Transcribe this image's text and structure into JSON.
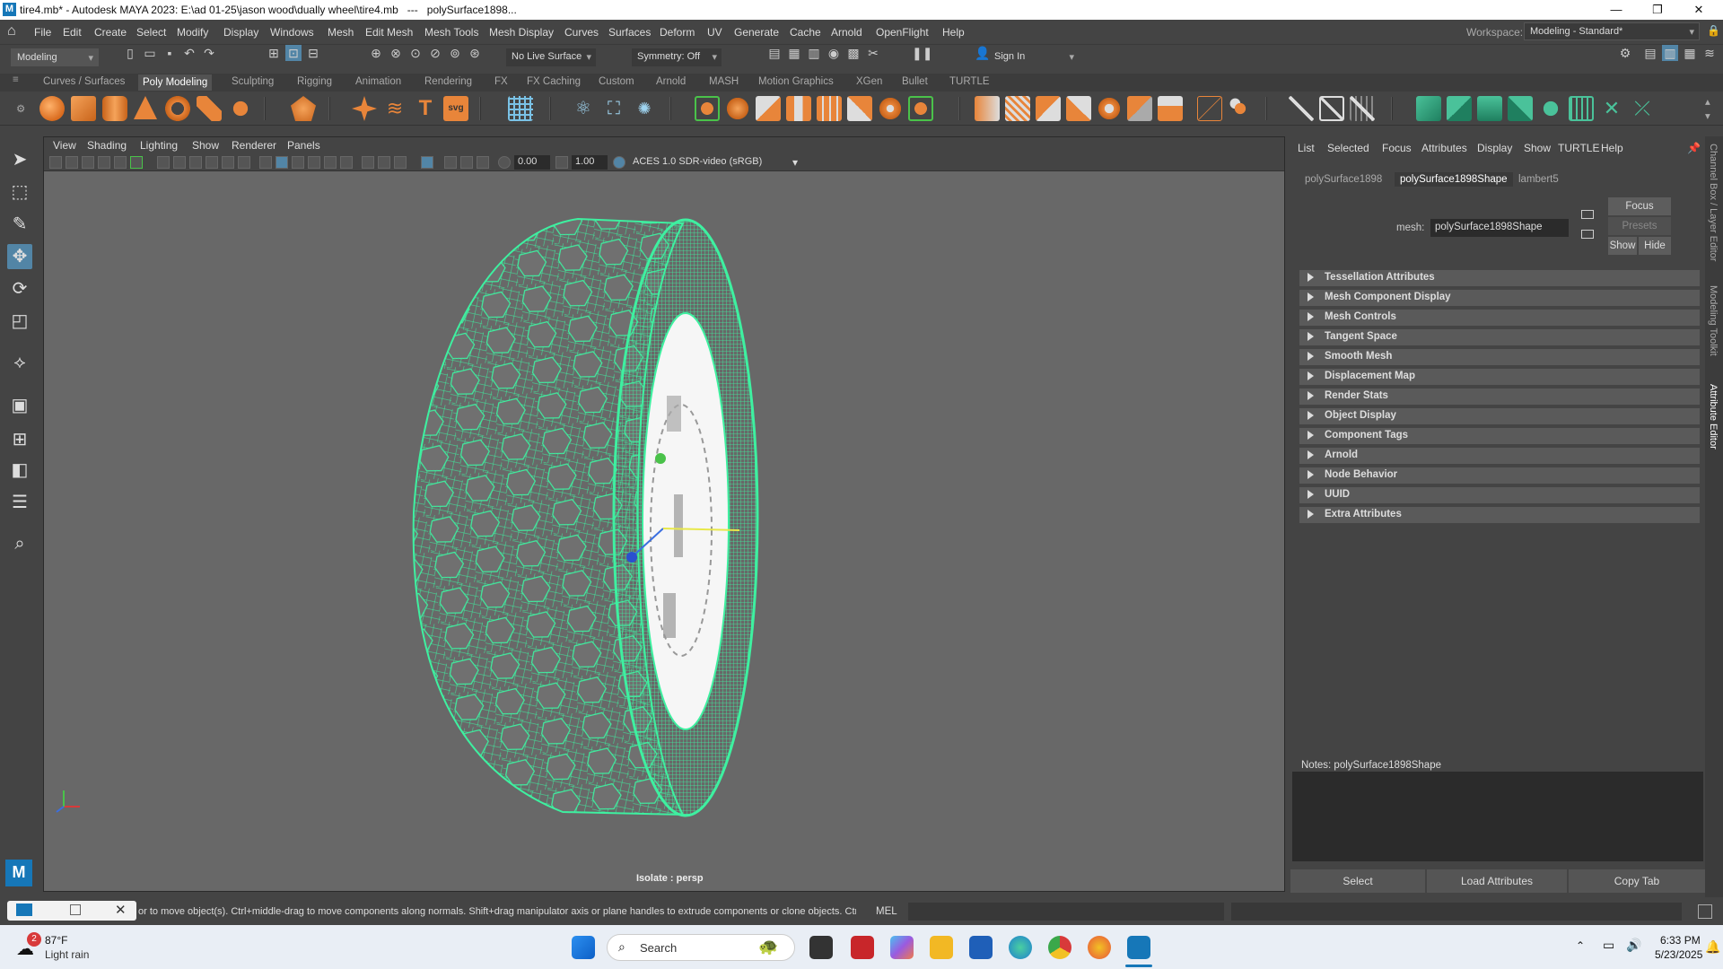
{
  "titlebar": {
    "text": "tire4.mb* - Autodesk MAYA 2023: E:\\ad 01-25\\jason wood\\dually wheel\\tire4.mb   ---   polySurface1898...",
    "minimize": "—",
    "maximize": "❐",
    "close": "✕"
  },
  "menubar": {
    "items": [
      "File",
      "Edit",
      "Create",
      "Select",
      "Modify",
      "Display",
      "Windows",
      "Mesh",
      "Edit Mesh",
      "Mesh Tools",
      "Mesh Display",
      "Curves",
      "Surfaces",
      "Deform",
      "UV",
      "Generate",
      "Cache",
      "Arnold",
      "OpenFlight",
      "Help"
    ],
    "workspace_label": "Workspace:",
    "workspace_value": "Modeling - Standard*"
  },
  "statusline": {
    "mode": "Modeling",
    "live_surface": "No Live Surface",
    "symmetry": "Symmetry: Off",
    "sign_in": "Sign In"
  },
  "shelf": {
    "tabs": [
      "Curves / Surfaces",
      "Poly Modeling",
      "Sculpting",
      "Rigging",
      "Animation",
      "Rendering",
      "FX",
      "FX Caching",
      "Custom",
      "Arnold",
      "MASH",
      "Motion Graphics",
      "XGen",
      "Bullet",
      "TURTLE"
    ],
    "active_tab": "Poly Modeling",
    "text_icon": "T",
    "svg_icon": "svg"
  },
  "viewport": {
    "menu": [
      "View",
      "Shading",
      "Lighting",
      "Show",
      "Renderer",
      "Panels"
    ],
    "exposure": "0.00",
    "gamma": "1.00",
    "color_space": "ACES 1.0 SDR-video (sRGB)",
    "camera_label": "Isolate : persp",
    "mesh_color": "#3ef0a0"
  },
  "attribute_editor": {
    "menu": [
      "List",
      "Selected",
      "Focus",
      "Attributes",
      "Display",
      "Show",
      "TURTLE",
      "Help"
    ],
    "node_tabs": [
      "polySurface1898",
      "polySurface1898Shape",
      "lambert5"
    ],
    "active_node_tab": "polySurface1898Shape",
    "mesh_label": "mesh:",
    "mesh_value": "polySurface1898Shape",
    "focus": "Focus",
    "presets": "Presets",
    "show": "Show",
    "hide": "Hide",
    "sections": [
      "Tessellation Attributes",
      "Mesh Component Display",
      "Mesh Controls",
      "Tangent Space",
      "Smooth Mesh",
      "Displacement Map",
      "Render Stats",
      "Object Display",
      "Component Tags",
      "Arnold",
      "Node Behavior",
      "UUID",
      "Extra Attributes"
    ],
    "notes_label": "Notes:  polySurface1898Shape",
    "buttons": [
      "Select",
      "Load Attributes",
      "Copy Tab"
    ]
  },
  "side_tabs": [
    "Channel Box / Layer Editor",
    "Modeling Toolkit",
    "Attribute Editor"
  ],
  "helpline": {
    "text": "or to move object(s). Ctrl+middle-drag to move components along normals. Shift+drag manipulator axis or plane handles to extrude components or clone objects. Ctrl+Shift+drag to",
    "lang": "MEL"
  },
  "taskbar": {
    "weather_badge": "2",
    "temperature": "87°F",
    "weather": "Light rain",
    "search_placeholder": "Search",
    "time": "6:33 PM",
    "date": "5/23/2025"
  }
}
